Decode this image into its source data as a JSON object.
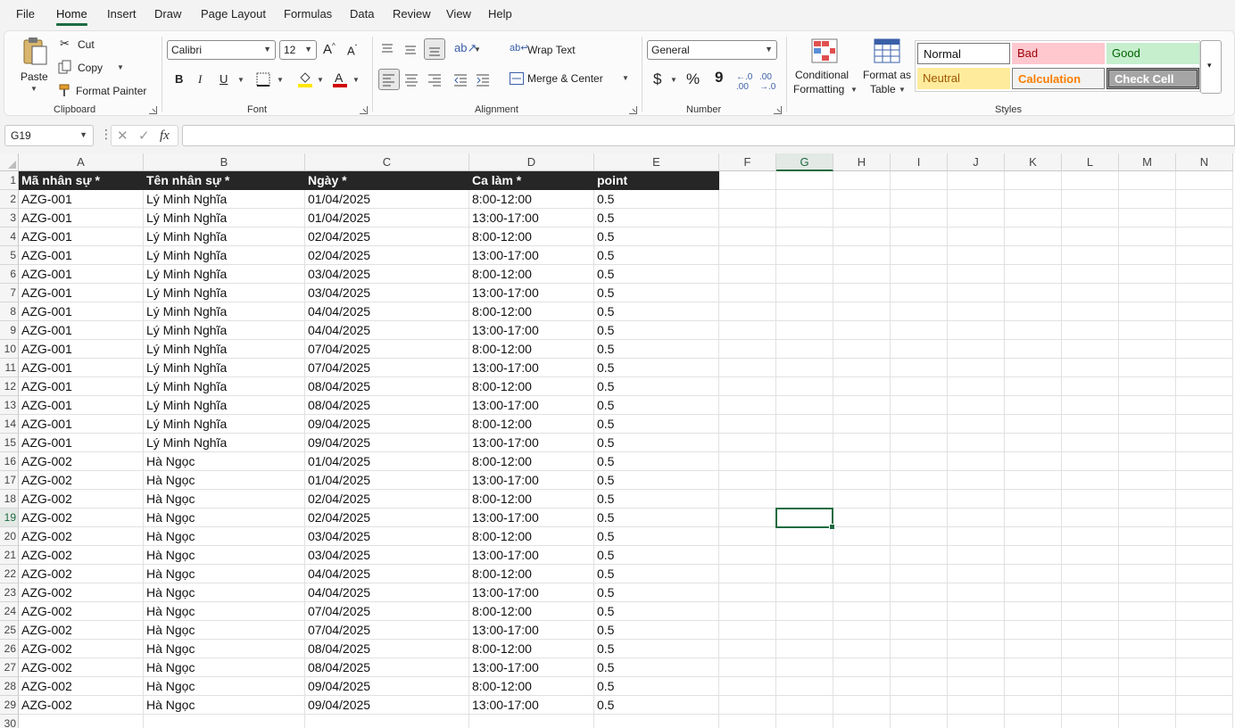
{
  "menu": {
    "tabs": [
      "File",
      "Home",
      "Insert",
      "Draw",
      "Page Layout",
      "Formulas",
      "Data",
      "Review",
      "View",
      "Help"
    ],
    "active": "Home"
  },
  "ribbon": {
    "clipboard": {
      "paste": "Paste",
      "cut": "Cut",
      "copy": "Copy",
      "format_painter": "Format Painter",
      "label": "Clipboard"
    },
    "font": {
      "name": "Calibri",
      "size": "12",
      "bold": "B",
      "italic": "I",
      "underline": "U",
      "font_color_letter": "A",
      "label": "Font",
      "highlight_color": "#ffe600",
      "font_color": "#d00000"
    },
    "alignment": {
      "wrap_text": "Wrap Text",
      "merge_center": "Merge & Center",
      "label": "Alignment"
    },
    "number": {
      "format": "General",
      "currency": "$",
      "percent": "%",
      "comma": "9",
      "label": "Number"
    },
    "conditional": {
      "line1": "Conditional",
      "line2": "Formatting"
    },
    "format_table": {
      "line1": "Format as",
      "line2": "Table"
    },
    "styles": {
      "normal": "Normal",
      "bad": "Bad",
      "good": "Good",
      "neutral": "Neutral",
      "calculation": "Calculation",
      "check_cell": "Check Cell",
      "label": "Styles"
    }
  },
  "formula_bar": {
    "name_box": "G19",
    "fx": "fx",
    "formula": ""
  },
  "sheet": {
    "columns": [
      "A",
      "B",
      "C",
      "D",
      "E",
      "F",
      "G",
      "H",
      "I",
      "J",
      "K",
      "L",
      "M",
      "N"
    ],
    "selected_column": "G",
    "selected_row": 19,
    "active_cell": "G19",
    "row_numbers": [
      1,
      2,
      3,
      4,
      5,
      6,
      7,
      8,
      9,
      10,
      11,
      12,
      13,
      14,
      15,
      16,
      17,
      18,
      19,
      20,
      21,
      22,
      23,
      24,
      25,
      26,
      27,
      28,
      29,
      30
    ],
    "header": [
      "Mã nhân sự *",
      "Tên nhân sự *",
      "Ngày *",
      "Ca làm *",
      "point"
    ],
    "rows": [
      [
        "AZG-001",
        "Lý Minh Nghĩa",
        "01/04/2025",
        "8:00-12:00",
        "0.5"
      ],
      [
        "AZG-001",
        "Lý Minh Nghĩa",
        "01/04/2025",
        "13:00-17:00",
        "0.5"
      ],
      [
        "AZG-001",
        "Lý Minh Nghĩa",
        "02/04/2025",
        "8:00-12:00",
        "0.5"
      ],
      [
        "AZG-001",
        "Lý Minh Nghĩa",
        "02/04/2025",
        "13:00-17:00",
        "0.5"
      ],
      [
        "AZG-001",
        "Lý Minh Nghĩa",
        "03/04/2025",
        "8:00-12:00",
        "0.5"
      ],
      [
        "AZG-001",
        "Lý Minh Nghĩa",
        "03/04/2025",
        "13:00-17:00",
        "0.5"
      ],
      [
        "AZG-001",
        "Lý Minh Nghĩa",
        "04/04/2025",
        "8:00-12:00",
        "0.5"
      ],
      [
        "AZG-001",
        "Lý Minh Nghĩa",
        "04/04/2025",
        "13:00-17:00",
        "0.5"
      ],
      [
        "AZG-001",
        "Lý Minh Nghĩa",
        "07/04/2025",
        "8:00-12:00",
        "0.5"
      ],
      [
        "AZG-001",
        "Lý Minh Nghĩa",
        "07/04/2025",
        "13:00-17:00",
        "0.5"
      ],
      [
        "AZG-001",
        "Lý Minh Nghĩa",
        "08/04/2025",
        "8:00-12:00",
        "0.5"
      ],
      [
        "AZG-001",
        "Lý Minh Nghĩa",
        "08/04/2025",
        "13:00-17:00",
        "0.5"
      ],
      [
        "AZG-001",
        "Lý Minh Nghĩa",
        "09/04/2025",
        "8:00-12:00",
        "0.5"
      ],
      [
        "AZG-001",
        "Lý Minh Nghĩa",
        "09/04/2025",
        "13:00-17:00",
        "0.5"
      ],
      [
        "AZG-002",
        "Hà Ngọc",
        "01/04/2025",
        "8:00-12:00",
        "0.5"
      ],
      [
        "AZG-002",
        "Hà Ngọc",
        "01/04/2025",
        "13:00-17:00",
        "0.5"
      ],
      [
        "AZG-002",
        "Hà Ngọc",
        "02/04/2025",
        "8:00-12:00",
        "0.5"
      ],
      [
        "AZG-002",
        "Hà Ngọc",
        "02/04/2025",
        "13:00-17:00",
        "0.5"
      ],
      [
        "AZG-002",
        "Hà Ngọc",
        "03/04/2025",
        "8:00-12:00",
        "0.5"
      ],
      [
        "AZG-002",
        "Hà Ngọc",
        "03/04/2025",
        "13:00-17:00",
        "0.5"
      ],
      [
        "AZG-002",
        "Hà Ngọc",
        "04/04/2025",
        "8:00-12:00",
        "0.5"
      ],
      [
        "AZG-002",
        "Hà Ngọc",
        "04/04/2025",
        "13:00-17:00",
        "0.5"
      ],
      [
        "AZG-002",
        "Hà Ngọc",
        "07/04/2025",
        "8:00-12:00",
        "0.5"
      ],
      [
        "AZG-002",
        "Hà Ngọc",
        "07/04/2025",
        "13:00-17:00",
        "0.5"
      ],
      [
        "AZG-002",
        "Hà Ngọc",
        "08/04/2025",
        "8:00-12:00",
        "0.5"
      ],
      [
        "AZG-002",
        "Hà Ngọc",
        "08/04/2025",
        "13:00-17:00",
        "0.5"
      ],
      [
        "AZG-002",
        "Hà Ngọc",
        "09/04/2025",
        "8:00-12:00",
        "0.5"
      ],
      [
        "AZG-002",
        "Hà Ngọc",
        "09/04/2025",
        "13:00-17:00",
        "0.5"
      ]
    ]
  }
}
